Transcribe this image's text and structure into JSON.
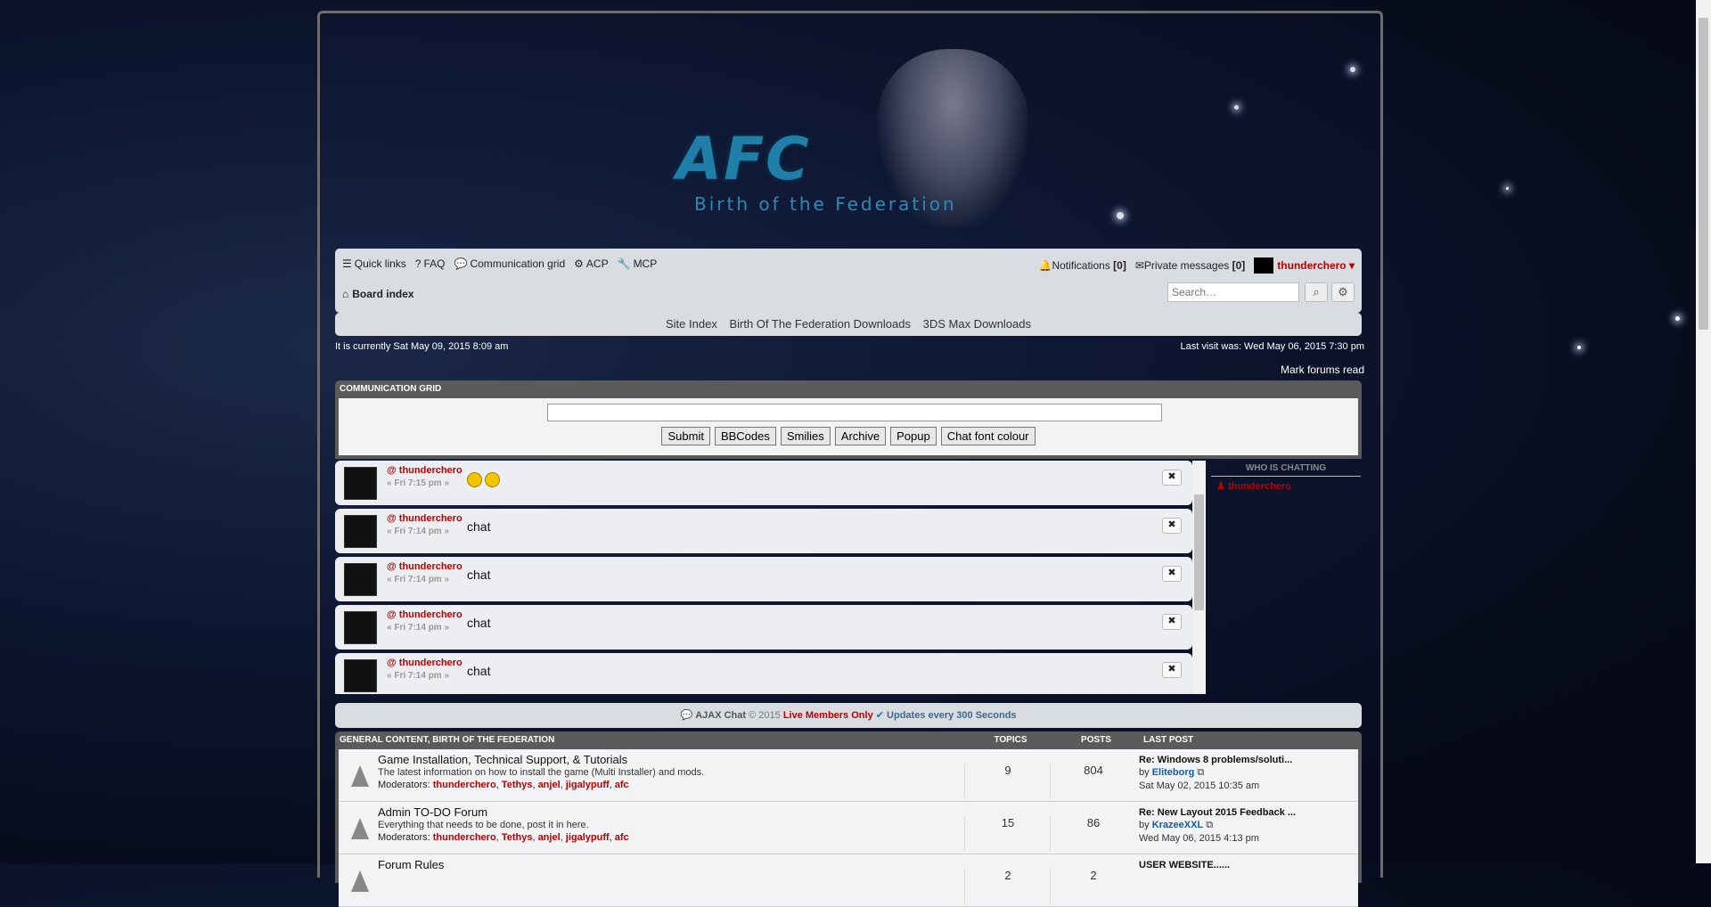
{
  "header": {
    "logo_main": "AFC",
    "logo_sub": "Birth of the Federation"
  },
  "nav": {
    "quick_links": "Quick links",
    "faq": "FAQ",
    "communication_grid": "Communication grid",
    "acp": "ACP",
    "mcp": "MCP",
    "notifications": "Notifications",
    "notifications_count": "[0]",
    "private_messages": "Private messages",
    "pm_count": "[0]",
    "username": "thunderchero ▾",
    "board_index": "Board index",
    "search_placeholder": "Search…"
  },
  "site_links": [
    "Site Index",
    "Birth Of The Federation Downloads",
    "3DS Max Downloads"
  ],
  "info": {
    "current_time": "It is currently Sat May 09, 2015 8:09 am",
    "last_visit": "Last visit was: Wed May 06, 2015 7:30 pm",
    "mark_read": "Mark forums read"
  },
  "chat": {
    "title": "COMMUNICATION GRID",
    "buttons": [
      "Submit",
      "BBCodes",
      "Smilies",
      "Archive",
      "Popup",
      "Chat font colour"
    ],
    "messages": [
      {
        "user": "@ thunderchero",
        "time": "« Fri 7:15 pm »",
        "text": "",
        "smilies": true
      },
      {
        "user": "@ thunderchero",
        "time": "« Fri 7:14 pm »",
        "text": "chat"
      },
      {
        "user": "@ thunderchero",
        "time": "« Fri 7:14 pm »",
        "text": "chat"
      },
      {
        "user": "@ thunderchero",
        "time": "« Fri 7:14 pm »",
        "text": "chat"
      },
      {
        "user": "@ thunderchero",
        "time": "« Fri 7:14 pm »",
        "text": "chat"
      }
    ],
    "close_label": "✖",
    "who_title": "WHO IS CHATTING",
    "who_users": [
      "thunderchero"
    ],
    "footer": {
      "name": "AJAX Chat",
      "copy": "© 2015",
      "live": "Live Members Only",
      "updates": "Updates every 300 Seconds"
    }
  },
  "forums": {
    "title": "GENERAL CONTENT, BIRTH OF THE FEDERATION",
    "col_topics": "TOPICS",
    "col_posts": "POSTS",
    "col_last": "LAST POST",
    "rows": [
      {
        "name": "Game Installation, Technical Support, & Tutorials",
        "desc": "The latest information on how to install the game (Multi Installer) and mods.",
        "mods_label": "Moderators:",
        "mods": [
          "thunderchero",
          "Tethys",
          "anjel",
          "jigalypuff",
          "afc"
        ],
        "topics": "9",
        "posts": "804",
        "last_title": "Re: Windows 8 problems/soluti...",
        "last_by_label": "by",
        "last_by": "Eliteborg",
        "last_date": "Sat May 02, 2015 10:35 am"
      },
      {
        "name": "Admin TO-DO Forum",
        "desc": "Everything that needs to be done, post it in here.",
        "mods_label": "Moderators:",
        "mods": [
          "thunderchero",
          "Tethys",
          "anjel",
          "jigalypuff",
          "afc"
        ],
        "topics": "15",
        "posts": "86",
        "last_title": "Re: New Layout 2015 Feedback ...",
        "last_by_label": "by",
        "last_by": "KrazeeXXL",
        "last_date": "Wed May 06, 2015 4:13 pm"
      },
      {
        "name": "Forum Rules",
        "desc": "",
        "mods_label": "",
        "mods": [],
        "topics": "2",
        "posts": "2",
        "last_title": "USER WEBSITE......",
        "last_by_label": "",
        "last_by": "",
        "last_date": ""
      }
    ]
  }
}
